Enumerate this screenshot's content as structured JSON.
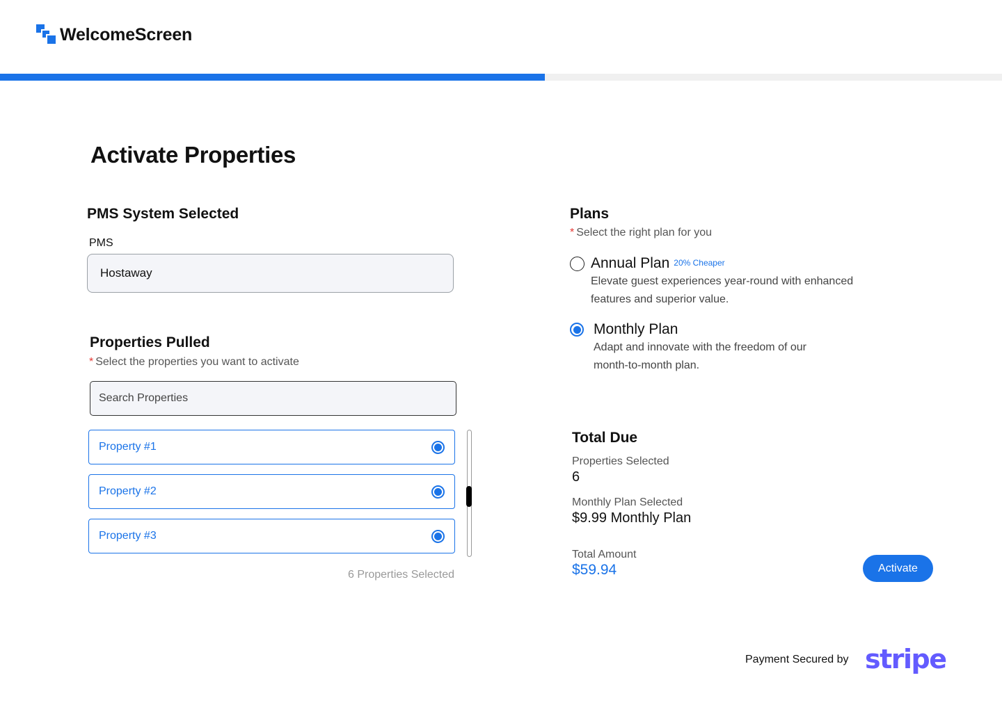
{
  "brand": {
    "name": "WelcomeScreen",
    "color": "#1a73e8"
  },
  "progress": {
    "percent": 54.4
  },
  "page": {
    "title": "Activate Properties"
  },
  "pms_section": {
    "title": "PMS System Selected",
    "field_label": "PMS",
    "value": "Hostaway"
  },
  "properties_section": {
    "title": "Properties Pulled",
    "required_mark": "*",
    "hint": "Select the properties you want to activate",
    "search_placeholder": "Search Properties",
    "items": [
      {
        "label": "Property #1",
        "selected": true
      },
      {
        "label": "Property #2",
        "selected": true
      },
      {
        "label": "Property #3",
        "selected": true
      }
    ],
    "selected_count_text": "6 Properties Selected"
  },
  "plans_section": {
    "title": "Plans",
    "required_mark": "*",
    "hint": "Select the right plan for you",
    "plans": [
      {
        "name": "Annual Plan",
        "badge": "20% Cheaper",
        "desc_line1": "Elevate guest experiences year-round with enhanced",
        "desc_line2": "features and superior value.",
        "selected": false
      },
      {
        "name": "Monthly Plan",
        "badge": "",
        "desc_line1": "Adapt and innovate with the freedom of our",
        "desc_line2": "month-to-month plan.",
        "selected": true
      }
    ]
  },
  "total_due": {
    "title": "Total Due",
    "properties_label": "Properties Selected",
    "properties_value": "6",
    "plan_label": "Monthly Plan Selected",
    "plan_value": "$9.99 Monthly Plan",
    "amount_label": "Total Amount",
    "amount_value": "$59.94",
    "activate_label": "Activate"
  },
  "footer": {
    "secured_text": "Payment Secured by",
    "stripe_logo": "stripe",
    "stripe_color": "#635bff"
  }
}
